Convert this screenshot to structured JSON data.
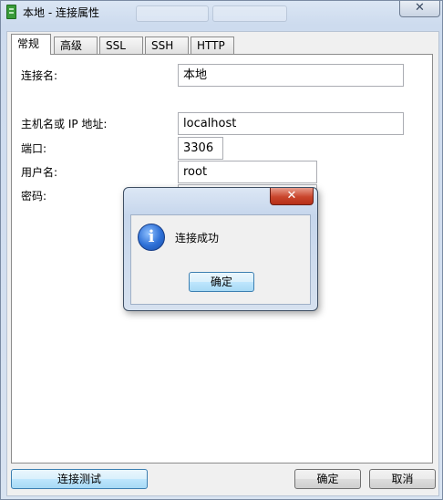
{
  "window": {
    "title": "本地 - 连接属性",
    "close": "✕"
  },
  "tabs": [
    "常规",
    "高级",
    "SSL",
    "SSH",
    "HTTP"
  ],
  "form": {
    "conn_name_label": "连接名:",
    "conn_name_value": "本地",
    "host_label": "主机名或 IP 地址:",
    "host_value": "localhost",
    "port_label": "端口:",
    "port_value": "3306",
    "user_label": "用户名:",
    "user_value": "root",
    "password_label": "密码:",
    "password_value": "••••••••"
  },
  "footer": {
    "test": "连接测试",
    "ok": "确定",
    "cancel": "取消"
  },
  "dialog": {
    "close": "✕",
    "message": "连接成功",
    "ok": "确定",
    "icon": "info-icon"
  }
}
